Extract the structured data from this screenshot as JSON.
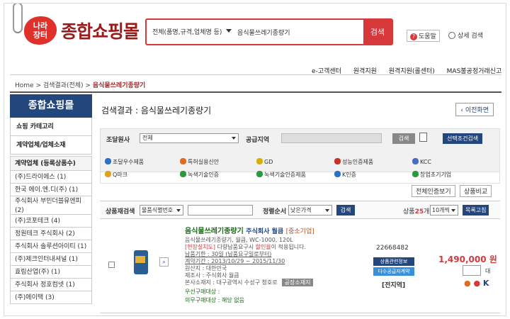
{
  "header": {
    "logo_badge": "나라\n장터",
    "logo_text": "종합쇼핑몰",
    "search": {
      "category": "전체(품명,규격,업체명 등)",
      "value": "음식물쓰레기종량기",
      "button": "검색"
    },
    "help": "도움말",
    "advanced": "상세 검색"
  },
  "top_nav": [
    "e-고객센터",
    "원격지원",
    "원격지원(콜센터)",
    "MAS불공정거래신고"
  ],
  "breadcrumb": {
    "home": "Home",
    "mid": "검색결과(전체)",
    "current": "음식물쓰레기종량기"
  },
  "sidebar": {
    "title": "종합쇼핑몰",
    "category": "쇼핑 카테고리",
    "sub": "계약업체/업체소재",
    "list_head": "계약업체 (등록상품수)",
    "items": [
      "(주)드라이에스 (1)",
      "한국 에이.엔.디(주) (1)",
      "주식회사 부민더블유엔피 (2)",
      "(주)코포테크 (4)",
      "정원테크 주식회사 (2)",
      "주식회사 솔루션아이티 (1)",
      "(주)제크인터내셔널 (1)",
      "효림산업(주) (1)",
      "주식회사 정호컴넷 (1)",
      "(주)에이택 (3)"
    ]
  },
  "main": {
    "title": "검색결과 : 음식물쓰레기종량기",
    "prev": "이전화면",
    "filter": {
      "agency_label": "조달원사",
      "agency_value": "전체",
      "region_label": "공급지역",
      "search_btn": "검색",
      "select_btn": "선택조건검색"
    },
    "certs": [
      "조달우수제품",
      "특허실용신안",
      "GD",
      "성능인증제품",
      "KCC",
      "Q마크",
      "녹색기술인증",
      "녹색기술인증제품",
      "K인증",
      "창업초기기업"
    ],
    "cert_colors": [
      "#2a73c9",
      "#e06a20",
      "#d9b000",
      "#c9302a",
      "#4a6cc0",
      "#e0a020",
      "#2a9a3a",
      "#2a9a3a",
      "#2a73c9",
      "#2a9a3a"
    ],
    "btn_cert_view": "전체인증보기",
    "btn_compare": "상품비교",
    "sort": {
      "in_search_label": "상품재검색",
      "in_search_sel": "물품식별번호",
      "order_label": "정렬순서",
      "order_sel": "낮은가격",
      "search_btn": "검색",
      "count_prefix": "상품",
      "count": "25",
      "count_suffix": "개씩",
      "per_page": "10개씩",
      "compare_btn": "목록고침"
    },
    "product": {
      "name": "음식물쓰레기종량기",
      "company": "주식회사 월큼",
      "tag": "[중소기업]",
      "desc": "음식물쓰레기종량기, 월큼, WC-1000, 120L",
      "promo_red": "[현장설치도]",
      "promo_text": " 다량납품요구시 ",
      "promo_discount": "할인율",
      "promo_tail": "이 적용됩니다.",
      "delivery": "납품기한 : 30일 (납품요구일로부터)",
      "contract": "계약기간 : 2013/10/29 ~ 2015/11/30",
      "origin": "원산지 : 대한민국",
      "maker": "제조사 : 주식회사 월큼",
      "address": "본사소재지 : 대구광역시 수성구 청호로",
      "vendor_btn": "공장소재지",
      "priority": "우선구매대상 :",
      "mandatory": "의무구매대상 : 해당 없음",
      "code": "22668482",
      "btn_info": "상품관련정보",
      "btn_contract": "다수공급자계약",
      "who": "[전지역]",
      "price": "1,490,000 원",
      "unit": "대"
    }
  }
}
